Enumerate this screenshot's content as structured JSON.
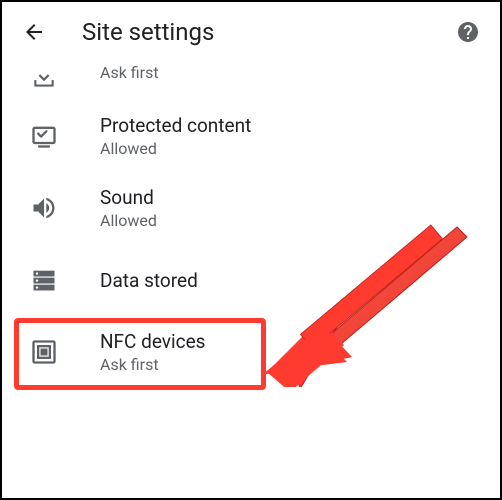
{
  "header": {
    "title": "Site settings"
  },
  "items": [
    {
      "title": "",
      "subtitle": "Ask first",
      "icon": "download-icon"
    },
    {
      "title": "Protected content",
      "subtitle": "Allowed",
      "icon": "protected-icon"
    },
    {
      "title": "Sound",
      "subtitle": "Allowed",
      "icon": "sound-icon"
    },
    {
      "title": "Data stored",
      "subtitle": "",
      "icon": "storage-icon"
    },
    {
      "title": "NFC devices",
      "subtitle": "Ask first",
      "icon": "nfc-icon"
    }
  ]
}
